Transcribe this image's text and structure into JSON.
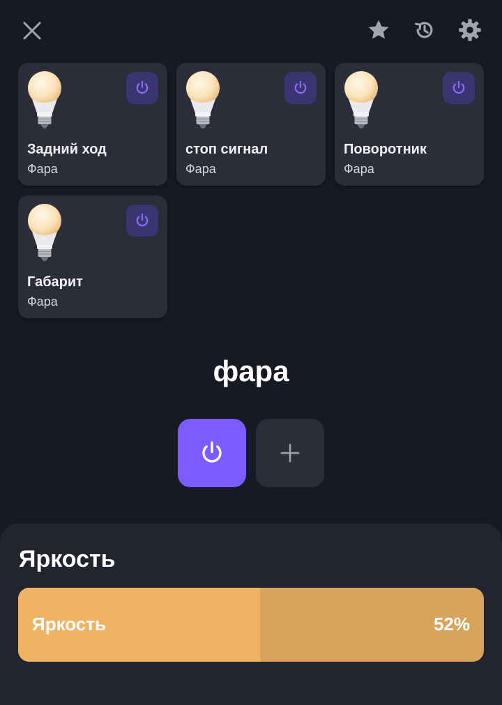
{
  "header": {
    "close_icon": "close-icon",
    "star_icon": "star-icon",
    "history_icon": "history-icon",
    "settings_icon": "gear-icon"
  },
  "devices": [
    {
      "name": "Задний ход",
      "type": "Фара",
      "icon": "bulb-icon",
      "power_icon": "power-icon"
    },
    {
      "name": "стоп сигнал",
      "type": "Фара",
      "icon": "bulb-icon",
      "power_icon": "power-icon"
    },
    {
      "name": "Поворотник",
      "type": "Фара",
      "icon": "bulb-icon",
      "power_icon": "power-icon"
    },
    {
      "name": "Габарит",
      "type": "Фара",
      "icon": "bulb-icon",
      "power_icon": "power-icon"
    }
  ],
  "group": {
    "title": "фара",
    "power_icon": "power-icon",
    "add_icon": "plus-icon"
  },
  "brightness": {
    "title": "Яркость",
    "slider_label": "Яркость",
    "value_text": "52%",
    "value": 0.52
  },
  "colors": {
    "background": "#171a24",
    "tile": "#2b2d39",
    "accent": "#7b5cff",
    "power_tile_bg": "#3a3570",
    "power_tile_icon": "#8a6cff",
    "slider_fill": "#eeb464",
    "slider_track": "#d8a35a"
  }
}
